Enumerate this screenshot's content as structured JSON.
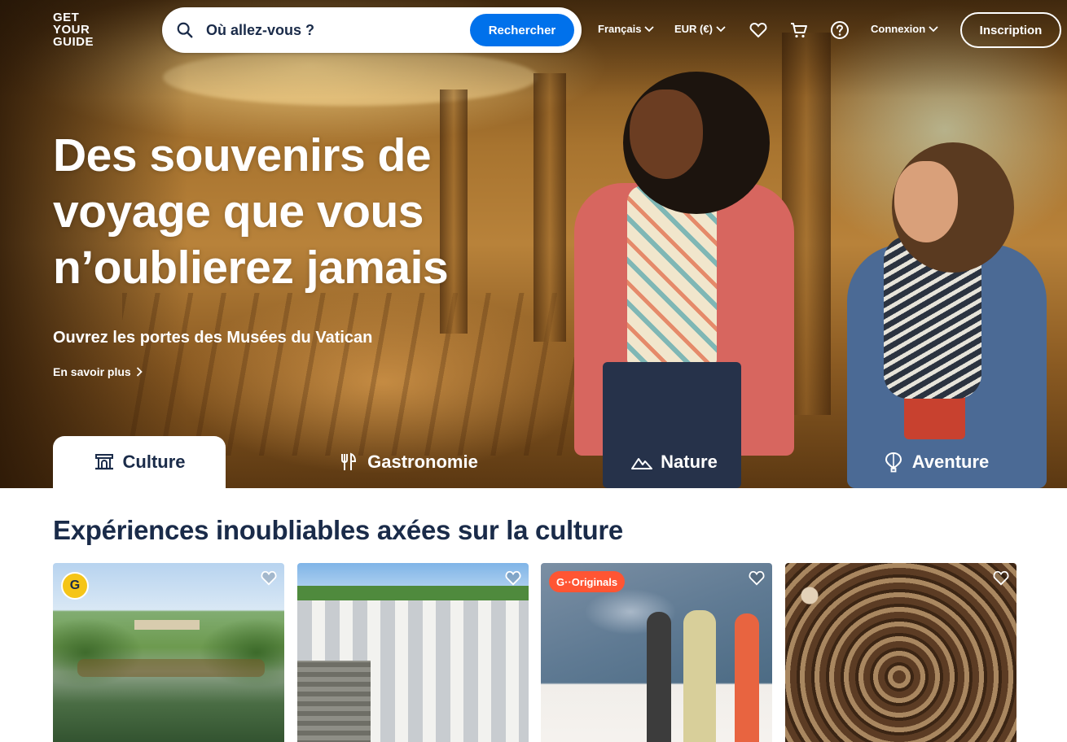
{
  "brand": {
    "line1": "GET",
    "line2": "YOUR",
    "line3": "GUIDE",
    "accent": "#0071eb"
  },
  "search": {
    "placeholder": "Où allez-vous ?",
    "button_label": "Rechercher"
  },
  "nav": {
    "language": "Français",
    "currency": "EUR (€)",
    "login": "Connexion",
    "signup": "Inscription",
    "icons": [
      "heart-icon",
      "cart-icon",
      "help-icon"
    ]
  },
  "hero": {
    "headline": "Des souvenirs de voyage que vous n’oublierez jamais",
    "subline": "Ouvrez les portes des Musées du Vatican",
    "link": "En savoir plus"
  },
  "tabs": [
    {
      "label": "Culture",
      "icon": "museum-icon",
      "active": true
    },
    {
      "label": "Gastronomie",
      "icon": "fork-knife-icon",
      "active": false
    },
    {
      "label": "Nature",
      "icon": "mountain-icon",
      "active": false
    },
    {
      "label": "Aventure",
      "icon": "balloon-icon",
      "active": false
    }
  ],
  "section": {
    "title": "Expériences inoubliables axées sur la culture",
    "cards": [
      {
        "badge": "G",
        "image": "versailles-gardens"
      },
      {
        "badge": "",
        "image": "alberobello-trulli"
      },
      {
        "badge": "G··Originals",
        "image": "orangerie-museum"
      },
      {
        "badge": "",
        "image": "paris-catacombs"
      }
    ]
  }
}
